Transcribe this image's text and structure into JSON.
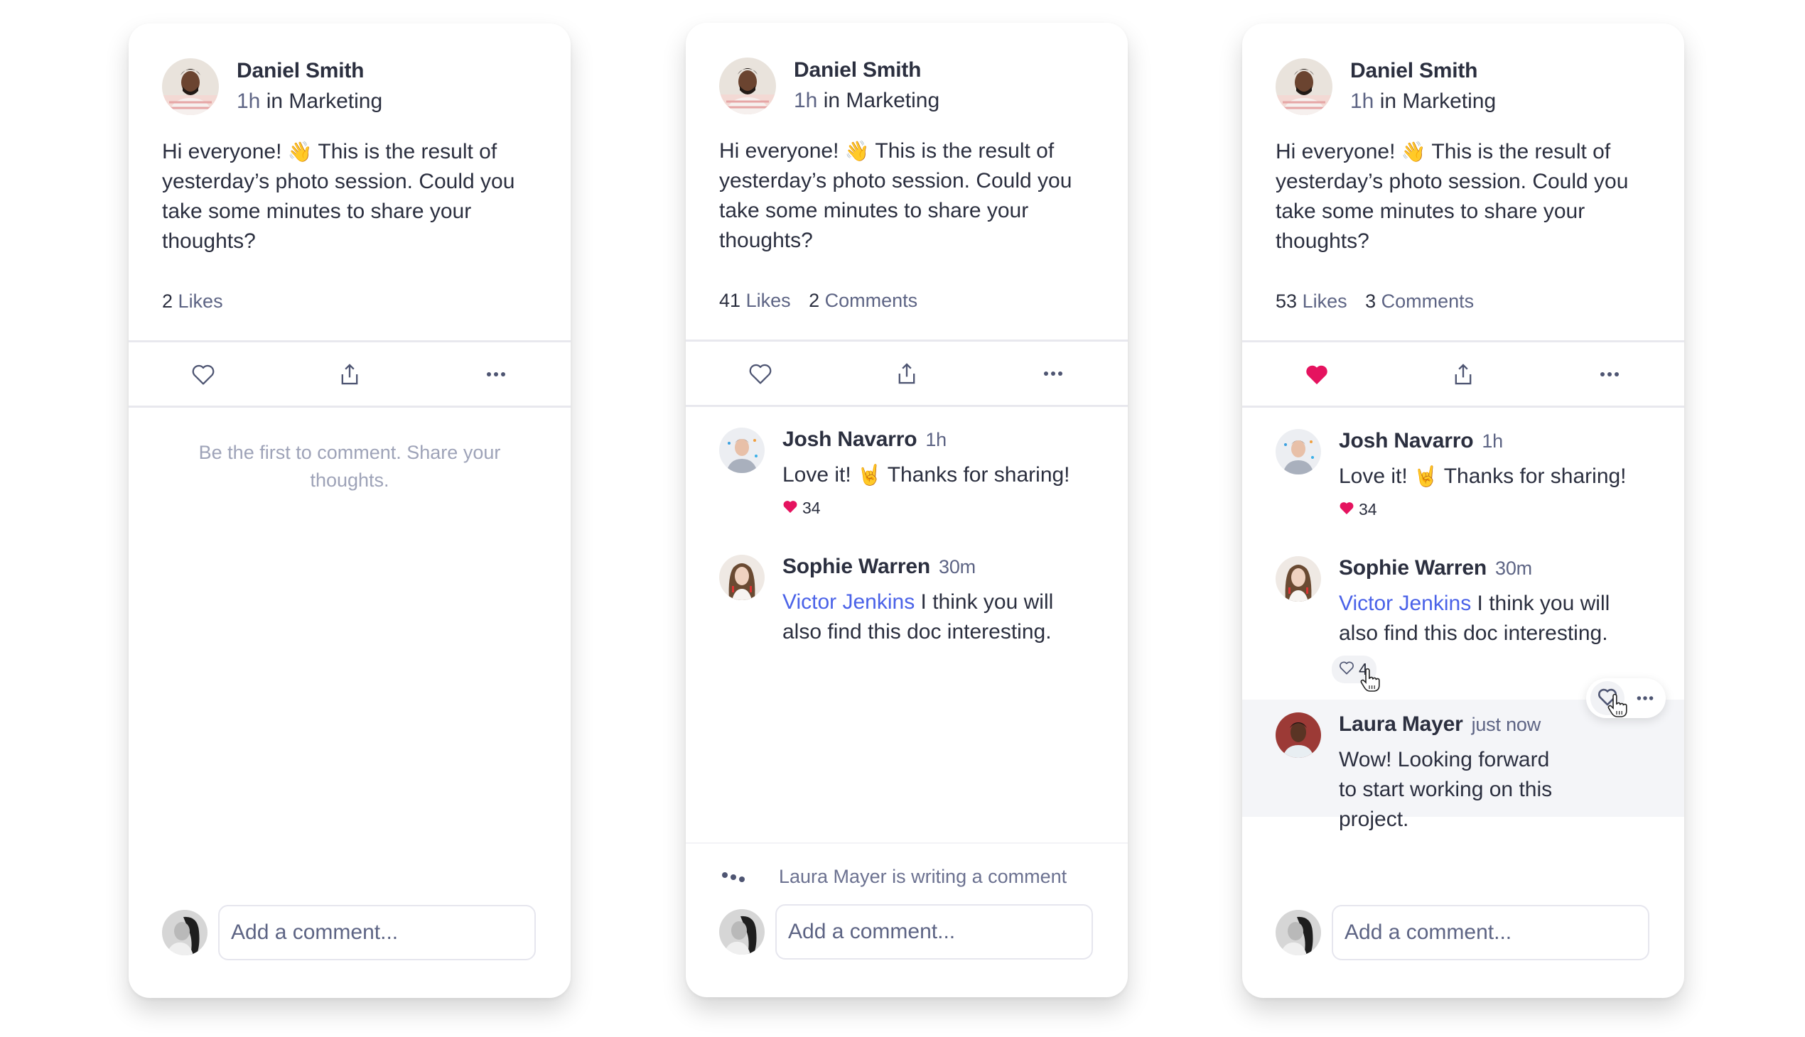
{
  "colors": {
    "text": "#2b2f3f",
    "muted": "#5d6484",
    "placeholder_muted": "#9ea3b8",
    "accent_like": "#e5135f",
    "mention": "#4a62e8",
    "highlight_bg": "#f4f5f8"
  },
  "cards": [
    {
      "post": {
        "author": "Daniel Smith",
        "time": "1h",
        "context": "in Marketing",
        "body_before_emoji": "Hi everyone! ",
        "emoji": "👋",
        "body_after_emoji": " This is the result of yesterday’s photo session. Could you take some minutes to share your thoughts?"
      },
      "stats": {
        "likes_count": "2",
        "likes_label": "Likes"
      },
      "actions": {
        "like_icon": "heart-outline-icon",
        "share_icon": "share-icon",
        "more_icon": "more-horizontal-icon",
        "liked": false
      },
      "empty_state": "Be the first to comment. Share your thoughts.",
      "composer": {
        "placeholder": "Add a comment..."
      }
    },
    {
      "post": {
        "author": "Daniel Smith",
        "time": "1h",
        "context": "in Marketing",
        "body_before_emoji": "Hi everyone! ",
        "emoji": "👋",
        "body_after_emoji": " This is the result of yesterday’s photo session. Could you take some minutes to share your thoughts?"
      },
      "stats": {
        "likes_count": "41",
        "likes_label": "Likes",
        "comments_count": "2",
        "comments_label": "Comments"
      },
      "actions": {
        "like_icon": "heart-outline-icon",
        "share_icon": "share-icon",
        "more_icon": "more-horizontal-icon",
        "liked": false
      },
      "comments": [
        {
          "author": "Josh Navarro",
          "time": "1h",
          "text_before_emoji": "Love it! ",
          "emoji": "🤘",
          "text_after_emoji": " Thanks for sharing!",
          "likes": "34",
          "liked": true
        },
        {
          "author": "Sophie Warren",
          "time": "30m",
          "mention": "Victor Jenkins",
          "text": " I think you will also find this doc interesting."
        }
      ],
      "typing_indicator": "Laura Mayer is writing a comment",
      "composer": {
        "placeholder": "Add a comment..."
      }
    },
    {
      "post": {
        "author": "Daniel Smith",
        "time": "1h",
        "context": "in Marketing",
        "body_before_emoji": "Hi everyone! ",
        "emoji": "👋",
        "body_after_emoji": " This is the result of yesterday’s photo session. Could you take some minutes to share your thoughts?"
      },
      "stats": {
        "likes_count": "53",
        "likes_label": "Likes",
        "comments_count": "3",
        "comments_label": "Comments"
      },
      "actions": {
        "like_icon": "heart-filled-icon",
        "share_icon": "share-icon",
        "more_icon": "more-horizontal-icon",
        "liked": true
      },
      "comments": [
        {
          "author": "Josh Navarro",
          "time": "1h",
          "text_before_emoji": "Love it! ",
          "emoji": "🤘",
          "text_after_emoji": " Thanks for sharing!",
          "likes": "34",
          "liked": true
        },
        {
          "author": "Sophie Warren",
          "time": "30m",
          "mention": "Victor Jenkins",
          "text": " I think you will also find this doc interesting.",
          "likes": "4",
          "liked": false,
          "hovered": true
        },
        {
          "author": "Laura Mayer",
          "time": "just now",
          "text": "Wow! Looking forward to start working on this project.",
          "highlighted": true
        }
      ],
      "hover_toolbar": {
        "like_icon": "heart-outline-icon",
        "more_icon": "more-horizontal-icon"
      },
      "composer": {
        "placeholder": "Add a comment..."
      }
    }
  ]
}
